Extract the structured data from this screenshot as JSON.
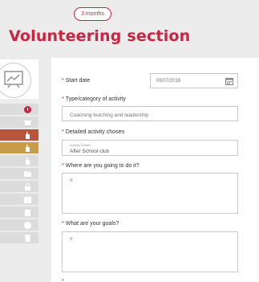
{
  "header": {
    "duration_badge": "3 months",
    "title": "Volunteering section"
  },
  "form": {
    "start_date": {
      "label": "Start date",
      "value": "05/07/2016"
    },
    "type": {
      "label": "Type/category of activity",
      "value": "Coaching teaching and leadership"
    },
    "activity": {
      "label": "Detailed activity chosen",
      "small_label": "Activity Details",
      "value": "After School club"
    },
    "where": {
      "label": "Where are you going to do it?",
      "value": "rr"
    },
    "goals": {
      "label": "What are your goals?",
      "value": "rr"
    },
    "required_marker": "*"
  },
  "sidebar": {
    "icons": [
      "avatar-chart-icon",
      "alert-icon",
      "gift-icon",
      "hand-icon",
      "hand-icon",
      "hand-icon",
      "folder-icon",
      "lock-icon",
      "calendar-icon",
      "clipboard-icon",
      "help-icon",
      "document-icon"
    ]
  },
  "colors": {
    "accent": "#cc2440",
    "rail_active_red": "#b8553f",
    "rail_active_gold": "#c99c4a",
    "rail_default": "#dcdcdc"
  }
}
